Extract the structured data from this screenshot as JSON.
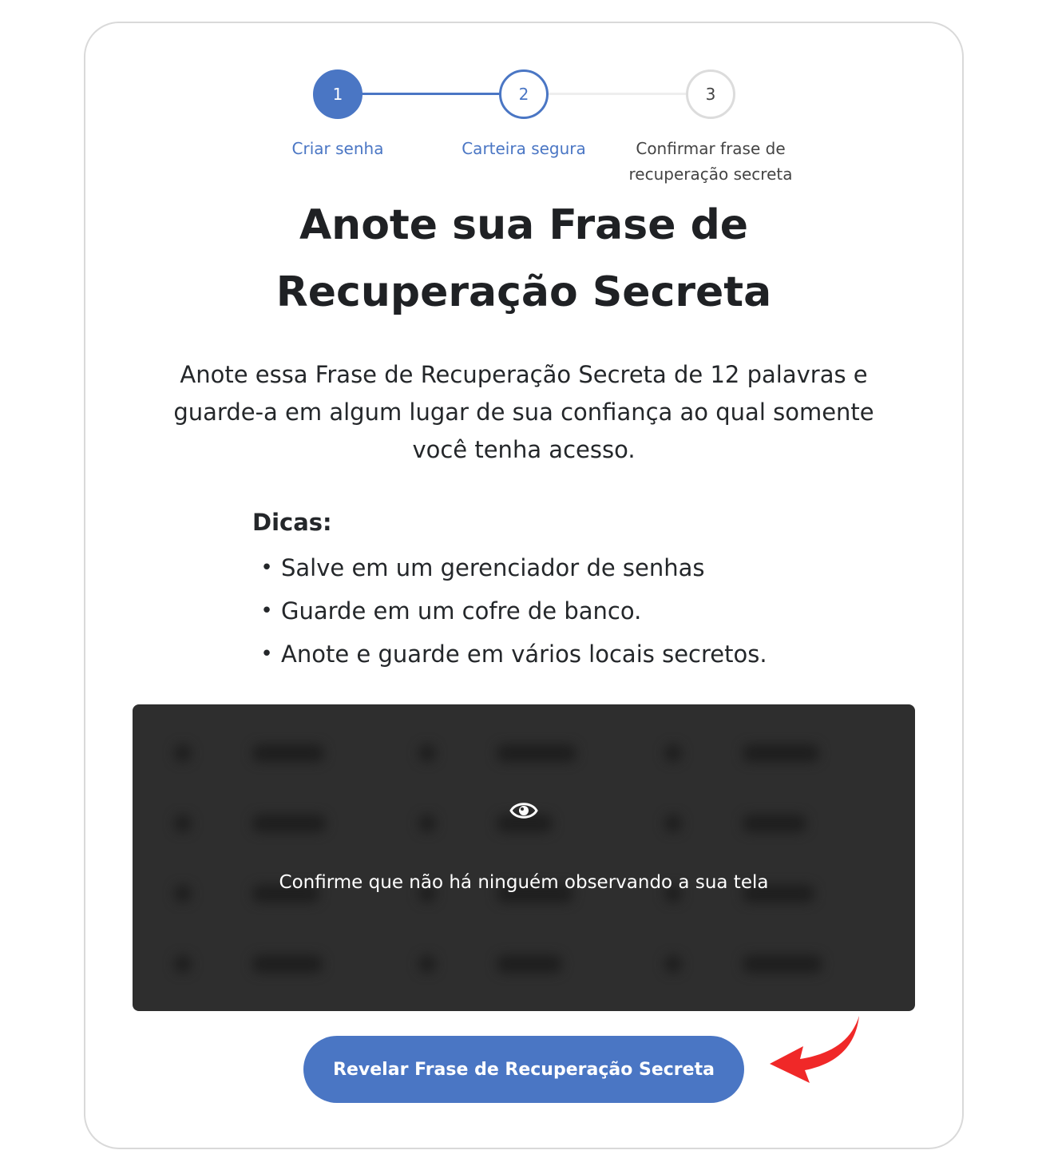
{
  "stepper": {
    "steps": [
      {
        "number": "1",
        "label": "Criar senha"
      },
      {
        "number": "2",
        "label": "Carteira segura"
      },
      {
        "number": "3",
        "label_line1": "Confirmar frase de",
        "label_line2": "recuperação secreta"
      }
    ],
    "active_color": "#4a76c4",
    "inactive_color": "#dcdcdc"
  },
  "title": {
    "line1": "Anote sua Frase de",
    "line2": "Recuperação Secreta"
  },
  "description": {
    "line1": "Anote essa Frase de Recuperação Secreta de 12 palavras e",
    "line2": "guarde-a em algum lugar de sua confiança ao qual somente",
    "line3": "você tenha acesso."
  },
  "tips": {
    "title": "Dicas:",
    "items": [
      "Salve em um gerenciador de senhas",
      "Guarde em um cofre de banco.",
      "Anote e guarde em vários locais secretos."
    ]
  },
  "phrase_box": {
    "icon": "eye-icon",
    "message": "Confirme que não há ninguém observando a sua tela",
    "background": "#2e2e2e"
  },
  "reveal_button": {
    "label": "Revelar Frase de Recuperação Secreta",
    "color": "#4a76c4"
  },
  "annotation": {
    "icon": "red-curved-arrow",
    "color": "#f02828"
  }
}
